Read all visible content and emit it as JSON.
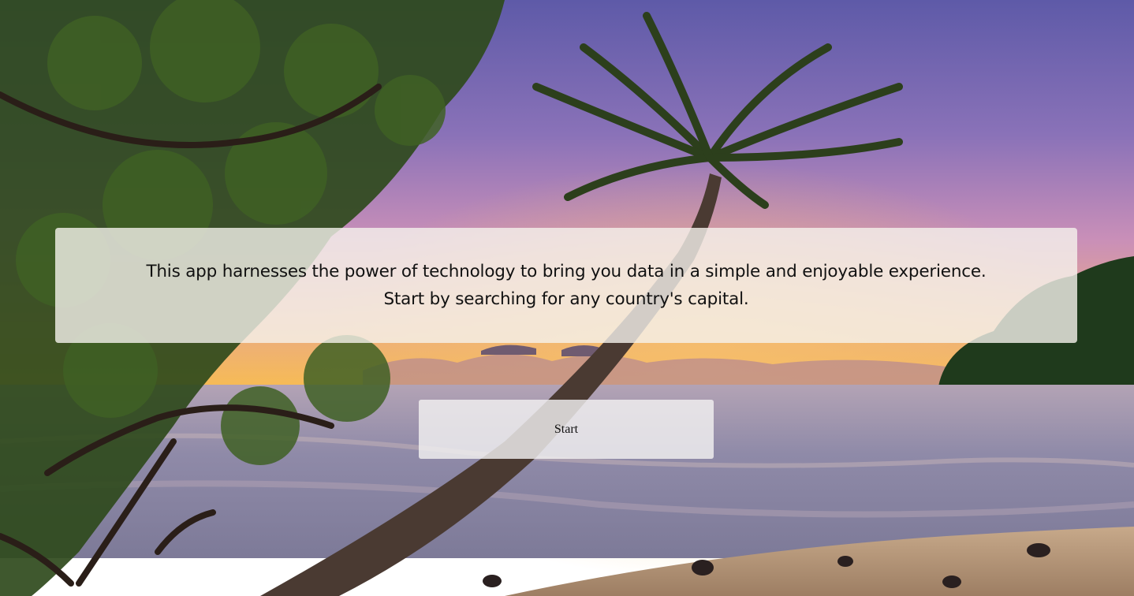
{
  "intro": {
    "line1": "This app harnesses the power of technology to bring you data in a simple and enjoyable experience.",
    "line2": "Start by searching for any country's capital."
  },
  "start_button": {
    "label": "Start"
  },
  "colors": {
    "sky_top": "#6a63b3",
    "sky_mid": "#c48ab8",
    "horizon": "#f0b45a",
    "sea": "#8f8aa8",
    "sand": "#b8987a",
    "foliage": "#2f4a1c"
  }
}
